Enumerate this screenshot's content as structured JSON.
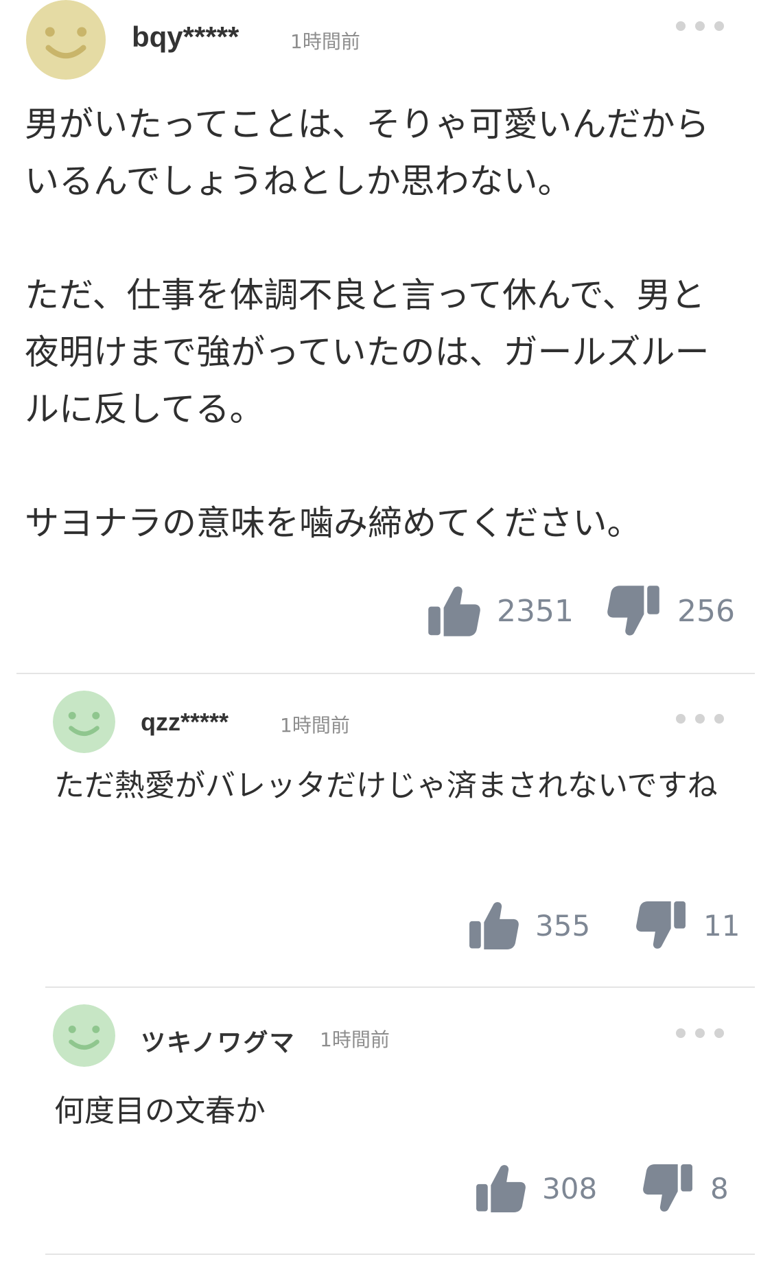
{
  "colors": {
    "avatar_yellow": "#e5dba4",
    "avatar_green": "#c7e6c5",
    "face_yellow": "#c9b56a",
    "face_green": "#8fc68e",
    "vote_icon": "#7e8794",
    "divider": "#e4e4e4",
    "more_dots": "#d3d3d3"
  },
  "comments": [
    {
      "username": "bqy*****",
      "time": "1時間前",
      "avatar_icon": "smiley-face-icon",
      "paragraphs": [
        "男がいたってことは、そりゃ可愛いんだからいるんでしょうねとしか思わない。",
        "ただ、仕事を体調不良と言って休んで、男と夜明けまで強がっていたのは、ガールズルールに反してる。",
        "サヨナラの意味を噛み締めてください。"
      ],
      "likes": "2351",
      "dislikes": "256"
    },
    {
      "username": "qzz*****",
      "time": "1時間前",
      "avatar_icon": "smiley-face-icon",
      "paragraphs": [
        "ただ熱愛がバレッタだけじゃ済まされないですね"
      ],
      "likes": "355",
      "dislikes": "11"
    },
    {
      "username": "ツキノワグマ",
      "time": "1時間前",
      "avatar_icon": "smiley-face-icon",
      "paragraphs": [
        "何度目の文春か"
      ],
      "likes": "308",
      "dislikes": "8"
    }
  ]
}
